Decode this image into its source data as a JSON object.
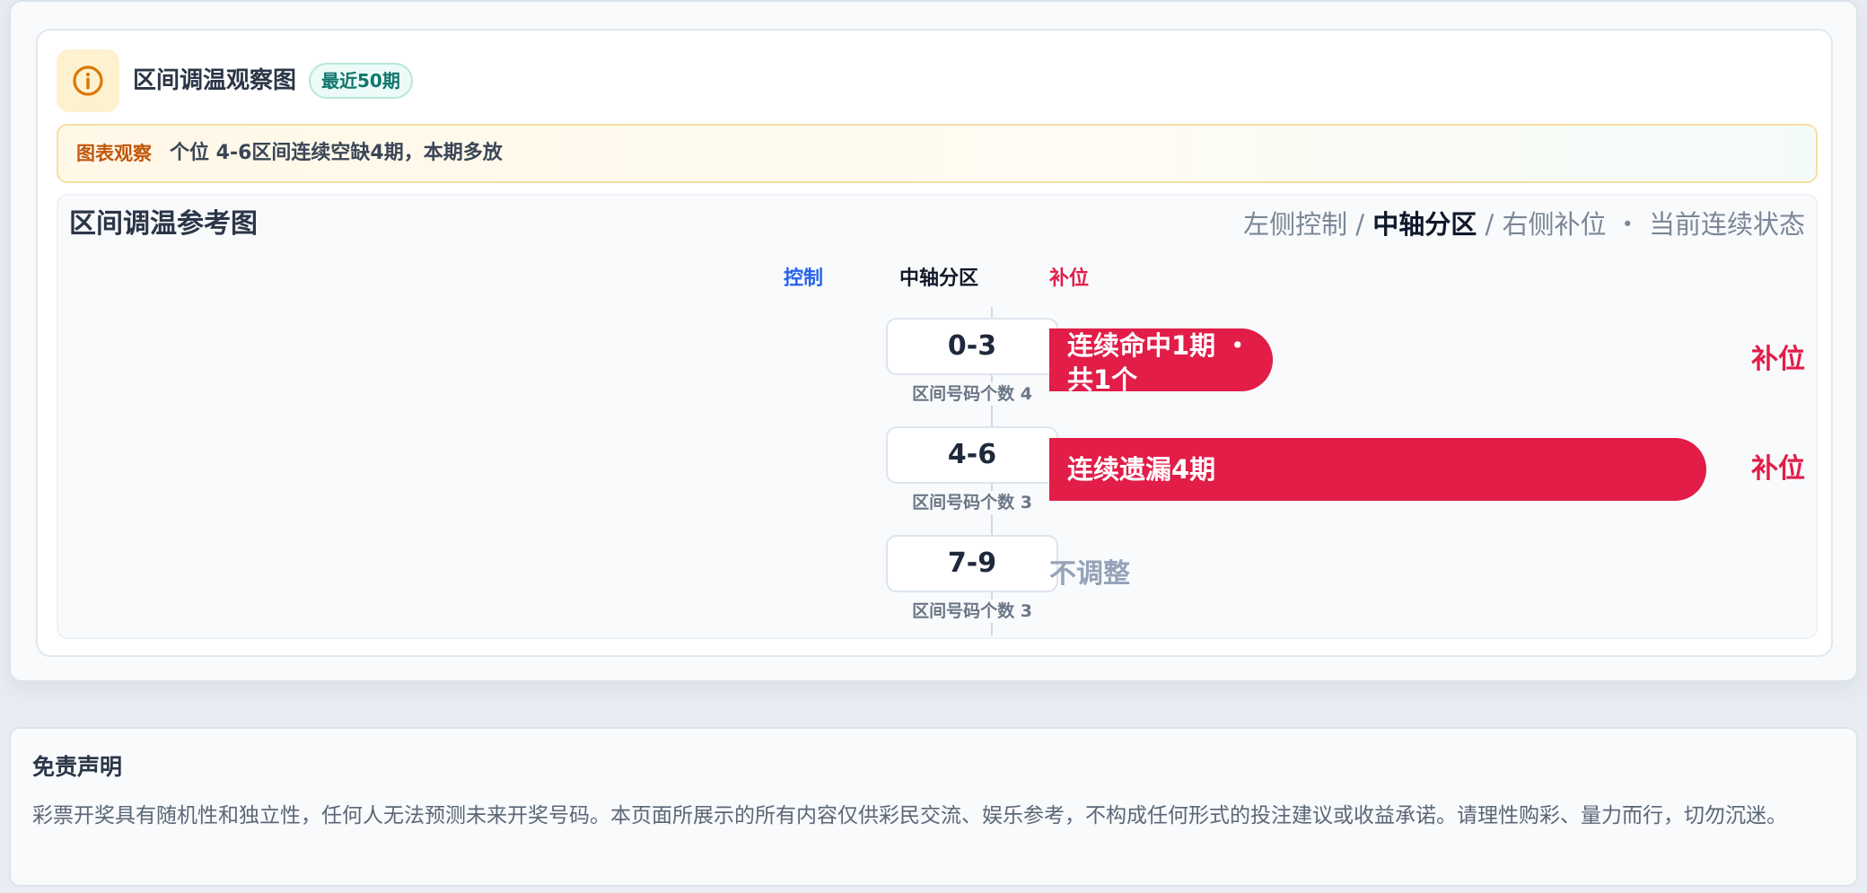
{
  "card": {
    "title": "区间调温观察图",
    "badge": "最近50期",
    "info_icon": "info-icon"
  },
  "observation": {
    "label": "图表观察",
    "text": "个位 4-6区间连续空缺4期，本期多放"
  },
  "chart": {
    "title": "区间调温参考图",
    "legend": {
      "left": "左侧控制",
      "sep1": " / ",
      "middle": "中轴分区",
      "sep2": " / ",
      "right": "右侧补位",
      "dot": " ・ ",
      "status": "当前连续状态"
    },
    "columns": {
      "control": "控制",
      "axis": "中轴分区",
      "fill": "补位"
    },
    "colors": {
      "control": "#2563eb",
      "fill": "#e11d48",
      "neutral": "#94a3b8"
    },
    "rows": [
      {
        "range": "0-3",
        "caption": "区间号码个数 4",
        "bar_text": "连续命中1期 ・ 共1个",
        "bar_fraction": 0.34,
        "side_label": "补位"
      },
      {
        "range": "4-6",
        "caption": "区间号码个数 3",
        "bar_text": "连续遗漏4期",
        "bar_fraction": 1.0,
        "side_label": "补位"
      },
      {
        "range": "7-9",
        "caption": "区间号码个数 3",
        "no_adjust": "不调整"
      }
    ]
  },
  "disclaimer": {
    "title": "免责声明",
    "text": "彩票开奖具有随机性和独立性，任何人无法预测未来开奖号码。本页面所展示的所有内容仅供彩民交流、娱乐参考，不构成任何形式的投注建议或收益承诺。请理性购彩、量力而行，切勿沉迷。"
  }
}
